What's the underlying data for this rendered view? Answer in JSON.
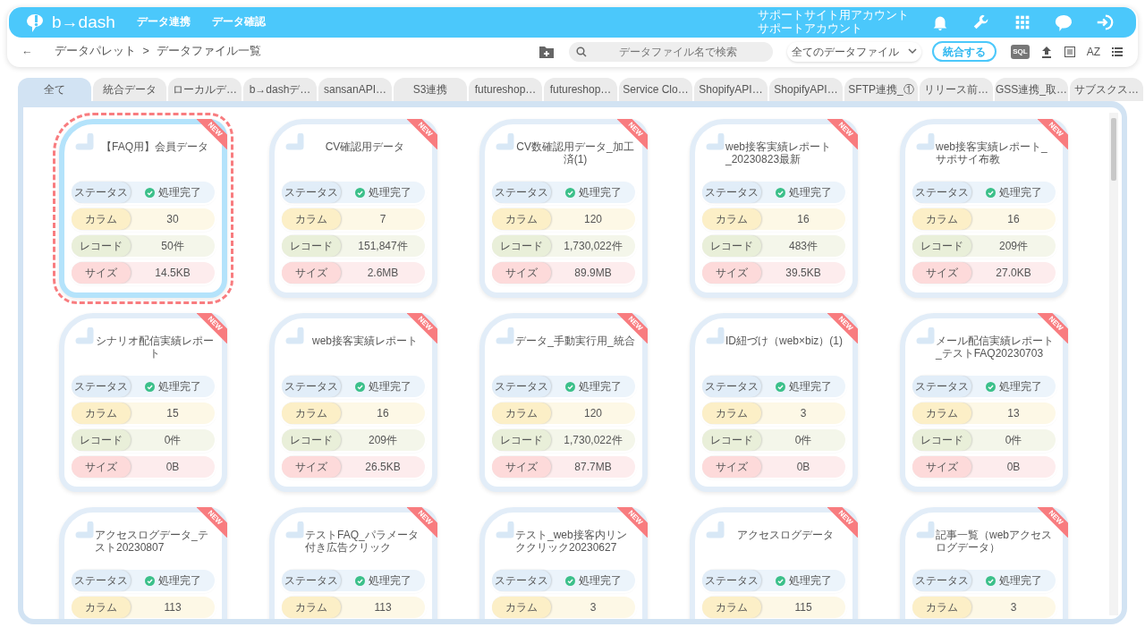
{
  "header": {
    "logo": "b→dash",
    "nav": [
      "データ連携",
      "データ確認"
    ],
    "account": [
      "サポートサイト用アカウント",
      "サポートアカウント"
    ]
  },
  "breadcrumb": {
    "back": "←",
    "items": [
      "データパレット",
      ">",
      "データファイル一覧"
    ]
  },
  "toolbar": {
    "search_placeholder": "データファイル名で検索",
    "filter": "全てのデータファイル",
    "merge_button": "統合する",
    "sql": "SQL",
    "sort": "AZ"
  },
  "tabs": [
    {
      "label": "全て",
      "selected": true
    },
    {
      "label": "統合データ",
      "selected": false
    },
    {
      "label": "ローカルデ…",
      "selected": false
    },
    {
      "label": "b→dashデ…",
      "selected": false
    },
    {
      "label": "sansanAPI…",
      "selected": false
    },
    {
      "label": "S3連携",
      "selected": false
    },
    {
      "label": "futureshop…",
      "selected": false
    },
    {
      "label": "futureshop…",
      "selected": false
    },
    {
      "label": "Service Clo…",
      "selected": false
    },
    {
      "label": "ShopifyAPI…",
      "selected": false
    },
    {
      "label": "ShopifyAPI…",
      "selected": false
    },
    {
      "label": "SFTP連携_①",
      "selected": false
    },
    {
      "label": "リリース前…",
      "selected": false
    },
    {
      "label": "GSS連携_取…",
      "selected": false
    },
    {
      "label": "サブスクス…",
      "selected": false
    }
  ],
  "files": [
    {
      "title": "【FAQ用】会員データ",
      "badge": "NEW",
      "selected": true,
      "fields": [
        {
          "kind": "status",
          "label": "ステータス",
          "value": "処理完了"
        },
        {
          "kind": "column",
          "label": "カラム",
          "value": "30"
        },
        {
          "kind": "record",
          "label": "レコード",
          "value": "50件"
        },
        {
          "kind": "size",
          "label": "サイズ",
          "value": "14.5KB"
        }
      ]
    },
    {
      "title": "CV確認用データ",
      "badge": "NEW",
      "selected": false,
      "fields": [
        {
          "kind": "status",
          "label": "ステータス",
          "value": "処理完了"
        },
        {
          "kind": "column",
          "label": "カラム",
          "value": "7"
        },
        {
          "kind": "record",
          "label": "レコード",
          "value": "151,847件"
        },
        {
          "kind": "size",
          "label": "サイズ",
          "value": "2.6MB"
        }
      ]
    },
    {
      "title": "CV数確認用データ_加工済(1)",
      "badge": "NEW",
      "selected": false,
      "fields": [
        {
          "kind": "status",
          "label": "ステータス",
          "value": "処理完了"
        },
        {
          "kind": "column",
          "label": "カラム",
          "value": "120"
        },
        {
          "kind": "record",
          "label": "レコード",
          "value": "1,730,022件"
        },
        {
          "kind": "size",
          "label": "サイズ",
          "value": "89.9MB"
        }
      ]
    },
    {
      "title": "web接客実績レポート_20230823最新",
      "badge": "NEW",
      "selected": false,
      "fields": [
        {
          "kind": "status",
          "label": "ステータス",
          "value": "処理完了"
        },
        {
          "kind": "column",
          "label": "カラム",
          "value": "16"
        },
        {
          "kind": "record",
          "label": "レコード",
          "value": "483件"
        },
        {
          "kind": "size",
          "label": "サイズ",
          "value": "39.5KB"
        }
      ]
    },
    {
      "title": "web接客実績レポート_サポサイ布教",
      "badge": "NEW",
      "selected": false,
      "fields": [
        {
          "kind": "status",
          "label": "ステータス",
          "value": "処理完了"
        },
        {
          "kind": "column",
          "label": "カラム",
          "value": "16"
        },
        {
          "kind": "record",
          "label": "レコード",
          "value": "209件"
        },
        {
          "kind": "size",
          "label": "サイズ",
          "value": "27.0KB"
        }
      ]
    },
    {
      "title": "シナリオ配信実績レポート",
      "badge": "NEW",
      "selected": false,
      "fields": [
        {
          "kind": "status",
          "label": "ステータス",
          "value": "処理完了"
        },
        {
          "kind": "column",
          "label": "カラム",
          "value": "15"
        },
        {
          "kind": "record",
          "label": "レコード",
          "value": "0件"
        },
        {
          "kind": "size",
          "label": "サイズ",
          "value": "0B"
        }
      ]
    },
    {
      "title": "web接客実績レポート",
      "badge": "NEW",
      "selected": false,
      "fields": [
        {
          "kind": "status",
          "label": "ステータス",
          "value": "処理完了"
        },
        {
          "kind": "column",
          "label": "カラム",
          "value": "16"
        },
        {
          "kind": "record",
          "label": "レコード",
          "value": "209件"
        },
        {
          "kind": "size",
          "label": "サイズ",
          "value": "26.5KB"
        }
      ]
    },
    {
      "title": "データ_手動実行用_統合",
      "badge": "NEW",
      "selected": false,
      "fields": [
        {
          "kind": "status",
          "label": "ステータス",
          "value": "処理完了"
        },
        {
          "kind": "column",
          "label": "カラム",
          "value": "120"
        },
        {
          "kind": "record",
          "label": "レコード",
          "value": "1,730,022件"
        },
        {
          "kind": "size",
          "label": "サイズ",
          "value": "87.7MB"
        }
      ]
    },
    {
      "title": "ID紐づけ（web×biz）(1)",
      "badge": "NEW",
      "selected": false,
      "fields": [
        {
          "kind": "status",
          "label": "ステータス",
          "value": "処理完了"
        },
        {
          "kind": "column",
          "label": "カラム",
          "value": "3"
        },
        {
          "kind": "record",
          "label": "レコード",
          "value": "0件"
        },
        {
          "kind": "size",
          "label": "サイズ",
          "value": "0B"
        }
      ]
    },
    {
      "title": "メール配信実績レポート_テストFAQ20230703",
      "badge": "NEW",
      "selected": false,
      "fields": [
        {
          "kind": "status",
          "label": "ステータス",
          "value": "処理完了"
        },
        {
          "kind": "column",
          "label": "カラム",
          "value": "13"
        },
        {
          "kind": "record",
          "label": "レコード",
          "value": "0件"
        },
        {
          "kind": "size",
          "label": "サイズ",
          "value": "0B"
        }
      ]
    },
    {
      "title": "アクセスログデータ_テスト20230807",
      "badge": "NEW",
      "selected": false,
      "fields": [
        {
          "kind": "status",
          "label": "ステータス",
          "value": "処理完了"
        },
        {
          "kind": "column",
          "label": "カラム",
          "value": "113"
        }
      ]
    },
    {
      "title": "テストFAQ_パラメータ付き広告クリック",
      "badge": "NEW",
      "selected": false,
      "fields": [
        {
          "kind": "status",
          "label": "ステータス",
          "value": "処理完了"
        },
        {
          "kind": "column",
          "label": "カラム",
          "value": "113"
        }
      ]
    },
    {
      "title": "テスト_web接客内リンククリック20230627",
      "badge": "NEW",
      "selected": false,
      "fields": [
        {
          "kind": "status",
          "label": "ステータス",
          "value": "処理完了"
        },
        {
          "kind": "column",
          "label": "カラム",
          "value": "3"
        }
      ]
    },
    {
      "title": "アクセスログデータ",
      "badge": "NEW",
      "selected": false,
      "fields": [
        {
          "kind": "status",
          "label": "ステータス",
          "value": "処理完了"
        },
        {
          "kind": "column",
          "label": "カラム",
          "value": "115"
        }
      ]
    },
    {
      "title": "記事一覧（webアクセスログデータ）",
      "badge": "NEW",
      "selected": false,
      "fields": [
        {
          "kind": "status",
          "label": "ステータス",
          "value": "処理完了"
        },
        {
          "kind": "column",
          "label": "カラム",
          "value": "3"
        }
      ]
    }
  ]
}
